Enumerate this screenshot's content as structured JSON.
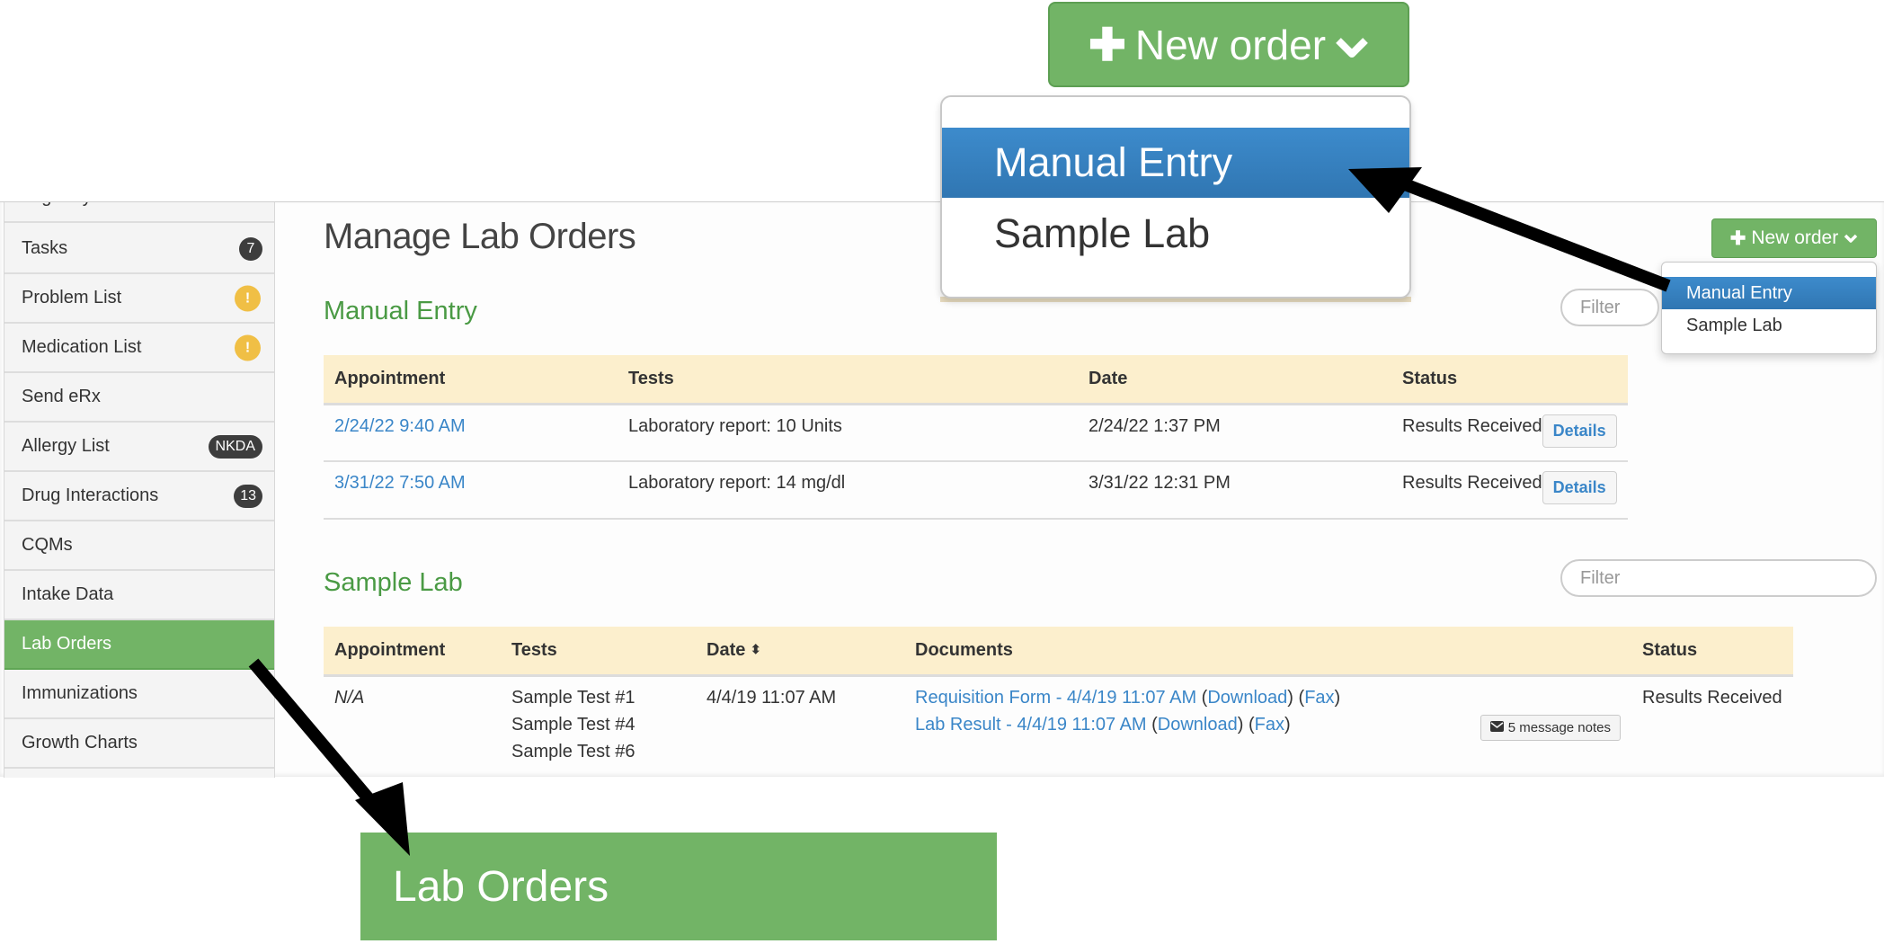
{
  "callouts": {
    "new_order_label": "New order",
    "dropdown_options": [
      "Manual Entry",
      "Sample Lab"
    ],
    "sidebar_highlight_label": "Lab Orders"
  },
  "sidebar": {
    "items": [
      {
        "label": "Eligibility",
        "badge": null
      },
      {
        "label": "Tasks",
        "badge": "7",
        "badge_type": "count"
      },
      {
        "label": "Problem List",
        "badge": "!",
        "badge_type": "warning"
      },
      {
        "label": "Medication List",
        "badge": "!",
        "badge_type": "warning"
      },
      {
        "label": "Send eRx",
        "badge": null
      },
      {
        "label": "Allergy List",
        "badge": "NKDA",
        "badge_type": "count"
      },
      {
        "label": "Drug Interactions",
        "badge": "13",
        "badge_type": "count"
      },
      {
        "label": "CQMs",
        "badge": null
      },
      {
        "label": "Intake Data",
        "badge": null
      },
      {
        "label": "Lab Orders",
        "badge": null,
        "active": true
      },
      {
        "label": "Immunizations",
        "badge": null
      },
      {
        "label": "Growth Charts",
        "badge": null
      }
    ]
  },
  "main": {
    "title": "Manage Lab Orders",
    "new_order": {
      "label": "New order",
      "options": [
        "Manual Entry",
        "Sample Lab"
      ],
      "highlighted": "Manual Entry"
    },
    "manual_entry": {
      "title": "Manual Entry",
      "filter_placeholder": "Filter",
      "columns": [
        "Appointment",
        "Tests",
        "Date",
        "Status"
      ],
      "rows": [
        {
          "appointment": "2/24/22 9:40 AM",
          "tests": "Laboratory report: 10 Units",
          "date": "2/24/22 1:37 PM",
          "status": "Results Received",
          "action": "Details"
        },
        {
          "appointment": "3/31/22 7:50 AM",
          "tests": "Laboratory report: 14 mg/dl",
          "date": "3/31/22 12:31 PM",
          "status": "Results Received",
          "action": "Details"
        }
      ]
    },
    "sample_lab": {
      "title": "Sample Lab",
      "filter_placeholder": "Filter",
      "columns": [
        "Appointment",
        "Tests",
        "Date",
        "Documents",
        "Status"
      ],
      "rows": [
        {
          "appointment": "N/A",
          "tests": [
            "Sample Test #1",
            "Sample Test #4",
            "Sample Test #6"
          ],
          "date": "4/4/19 11:07 AM",
          "documents": [
            {
              "name": "Requisition Form - 4/4/19 11:07 AM",
              "download": "Download",
              "fax": "Fax"
            },
            {
              "name": "Lab Result - 4/4/19 11:07 AM",
              "download": "Download",
              "fax": "Fax"
            }
          ],
          "notes_label": "5 message notes",
          "status": "Results Received"
        }
      ]
    }
  },
  "colors": {
    "brand_green": "#72b466",
    "section_green": "#4a9a44",
    "selected_blue": "#3580c0",
    "link_blue": "#3a86c8",
    "table_header": "#fcefcd",
    "warning_badge": "#f0bf45",
    "count_badge": "#3d3d3d"
  }
}
